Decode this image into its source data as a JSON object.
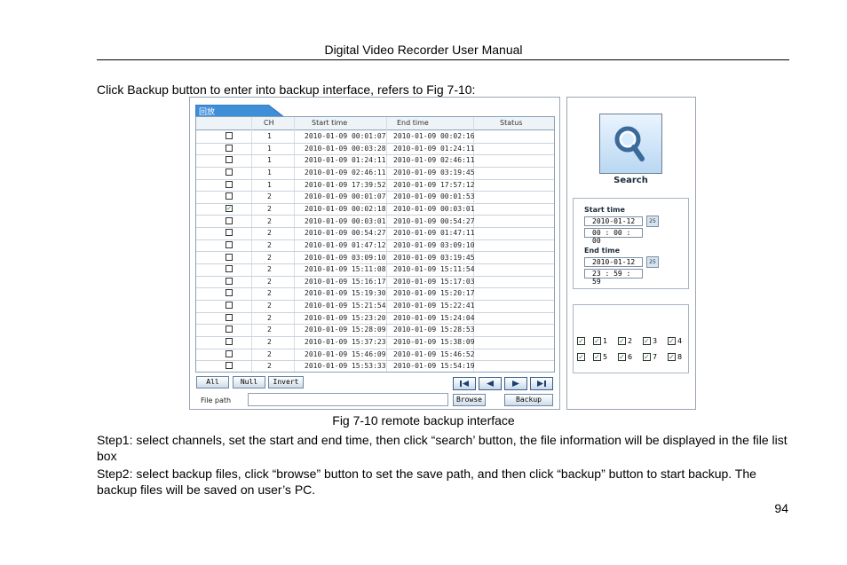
{
  "header": {
    "title": "Digital Video Recorder User Manual"
  },
  "intro": "Click Backup button to enter into backup interface, refers to Fig 7-10:",
  "ui": {
    "tab_label": "回放",
    "table": {
      "columns": [
        "CH",
        "Start time",
        "End time",
        "Status"
      ],
      "rows": [
        {
          "checked": false,
          "ch": "1",
          "start": "2010-01-09 00:01:07",
          "end": "2010-01-09 00:02:16"
        },
        {
          "checked": false,
          "ch": "1",
          "start": "2010-01-09 00:03:28",
          "end": "2010-01-09 01:24:11"
        },
        {
          "checked": false,
          "ch": "1",
          "start": "2010-01-09 01:24:11",
          "end": "2010-01-09 02:46:11"
        },
        {
          "checked": false,
          "ch": "1",
          "start": "2010-01-09 02:46:11",
          "end": "2010-01-09 03:19:45"
        },
        {
          "checked": false,
          "ch": "1",
          "start": "2010-01-09 17:39:52",
          "end": "2010-01-09 17:57:12"
        },
        {
          "checked": false,
          "ch": "2",
          "start": "2010-01-09 00:01:07",
          "end": "2010-01-09 00:01:53"
        },
        {
          "checked": true,
          "ch": "2",
          "start": "2010-01-09 00:02:18",
          "end": "2010-01-09 00:03:01"
        },
        {
          "checked": false,
          "ch": "2",
          "start": "2010-01-09 00:03:01",
          "end": "2010-01-09 00:54:27"
        },
        {
          "checked": false,
          "ch": "2",
          "start": "2010-01-09 00:54:27",
          "end": "2010-01-09 01:47:11"
        },
        {
          "checked": false,
          "ch": "2",
          "start": "2010-01-09 01:47:12",
          "end": "2010-01-09 03:09:10"
        },
        {
          "checked": false,
          "ch": "2",
          "start": "2010-01-09 03:09:10",
          "end": "2010-01-09 03:19:45"
        },
        {
          "checked": false,
          "ch": "2",
          "start": "2010-01-09 15:11:08",
          "end": "2010-01-09 15:11:54"
        },
        {
          "checked": false,
          "ch": "2",
          "start": "2010-01-09 15:16:17",
          "end": "2010-01-09 15:17:03"
        },
        {
          "checked": false,
          "ch": "2",
          "start": "2010-01-09 15:19:30",
          "end": "2010-01-09 15:20:17"
        },
        {
          "checked": false,
          "ch": "2",
          "start": "2010-01-09 15:21:54",
          "end": "2010-01-09 15:22:41"
        },
        {
          "checked": false,
          "ch": "2",
          "start": "2010-01-09 15:23:20",
          "end": "2010-01-09 15:24:04"
        },
        {
          "checked": false,
          "ch": "2",
          "start": "2010-01-09 15:28:09",
          "end": "2010-01-09 15:28:53"
        },
        {
          "checked": false,
          "ch": "2",
          "start": "2010-01-09 15:37:23",
          "end": "2010-01-09 15:38:09"
        },
        {
          "checked": false,
          "ch": "2",
          "start": "2010-01-09 15:46:09",
          "end": "2010-01-09 15:46:52"
        },
        {
          "checked": false,
          "ch": "2",
          "start": "2010-01-09 15:53:33",
          "end": "2010-01-09 15:54:19"
        }
      ]
    },
    "buttons": {
      "all": "All",
      "null": "Null",
      "invert": "Invert",
      "browse": "Browse",
      "backup": "Backup"
    },
    "nav_icons": [
      "first-page-icon",
      "prev-page-icon",
      "next-page-icon",
      "last-page-icon"
    ],
    "file_path_label": "File path",
    "file_path_value": "",
    "search_label": "Search",
    "start_time_label": "Start time",
    "start_date": "2010-01-12",
    "start_clock": "00 : 00 : 00",
    "end_time_label": "End time",
    "end_date": "2010-01-12",
    "end_clock": "23 : 59 : 59",
    "calendar_icon_text": "25",
    "channels": [
      {
        "num": "1",
        "checked": true
      },
      {
        "num": "2",
        "checked": true
      },
      {
        "num": "3",
        "checked": true
      },
      {
        "num": "4",
        "checked": true
      },
      {
        "num": "5",
        "checked": true
      },
      {
        "num": "6",
        "checked": true
      },
      {
        "num": "7",
        "checked": true
      },
      {
        "num": "8",
        "checked": true
      }
    ],
    "all_channels_checked": true
  },
  "caption": "Fig 7-10 remote backup interface",
  "steps": [
    "Step1: select channels, set the start and end time, then click “search’ button, the file information will be displayed in the file list box",
    "Step2: select backup files, click “browse” button to set the save path, and then click “backup” button to start backup. The backup files will be saved on user’s PC."
  ],
  "page_number": "94"
}
